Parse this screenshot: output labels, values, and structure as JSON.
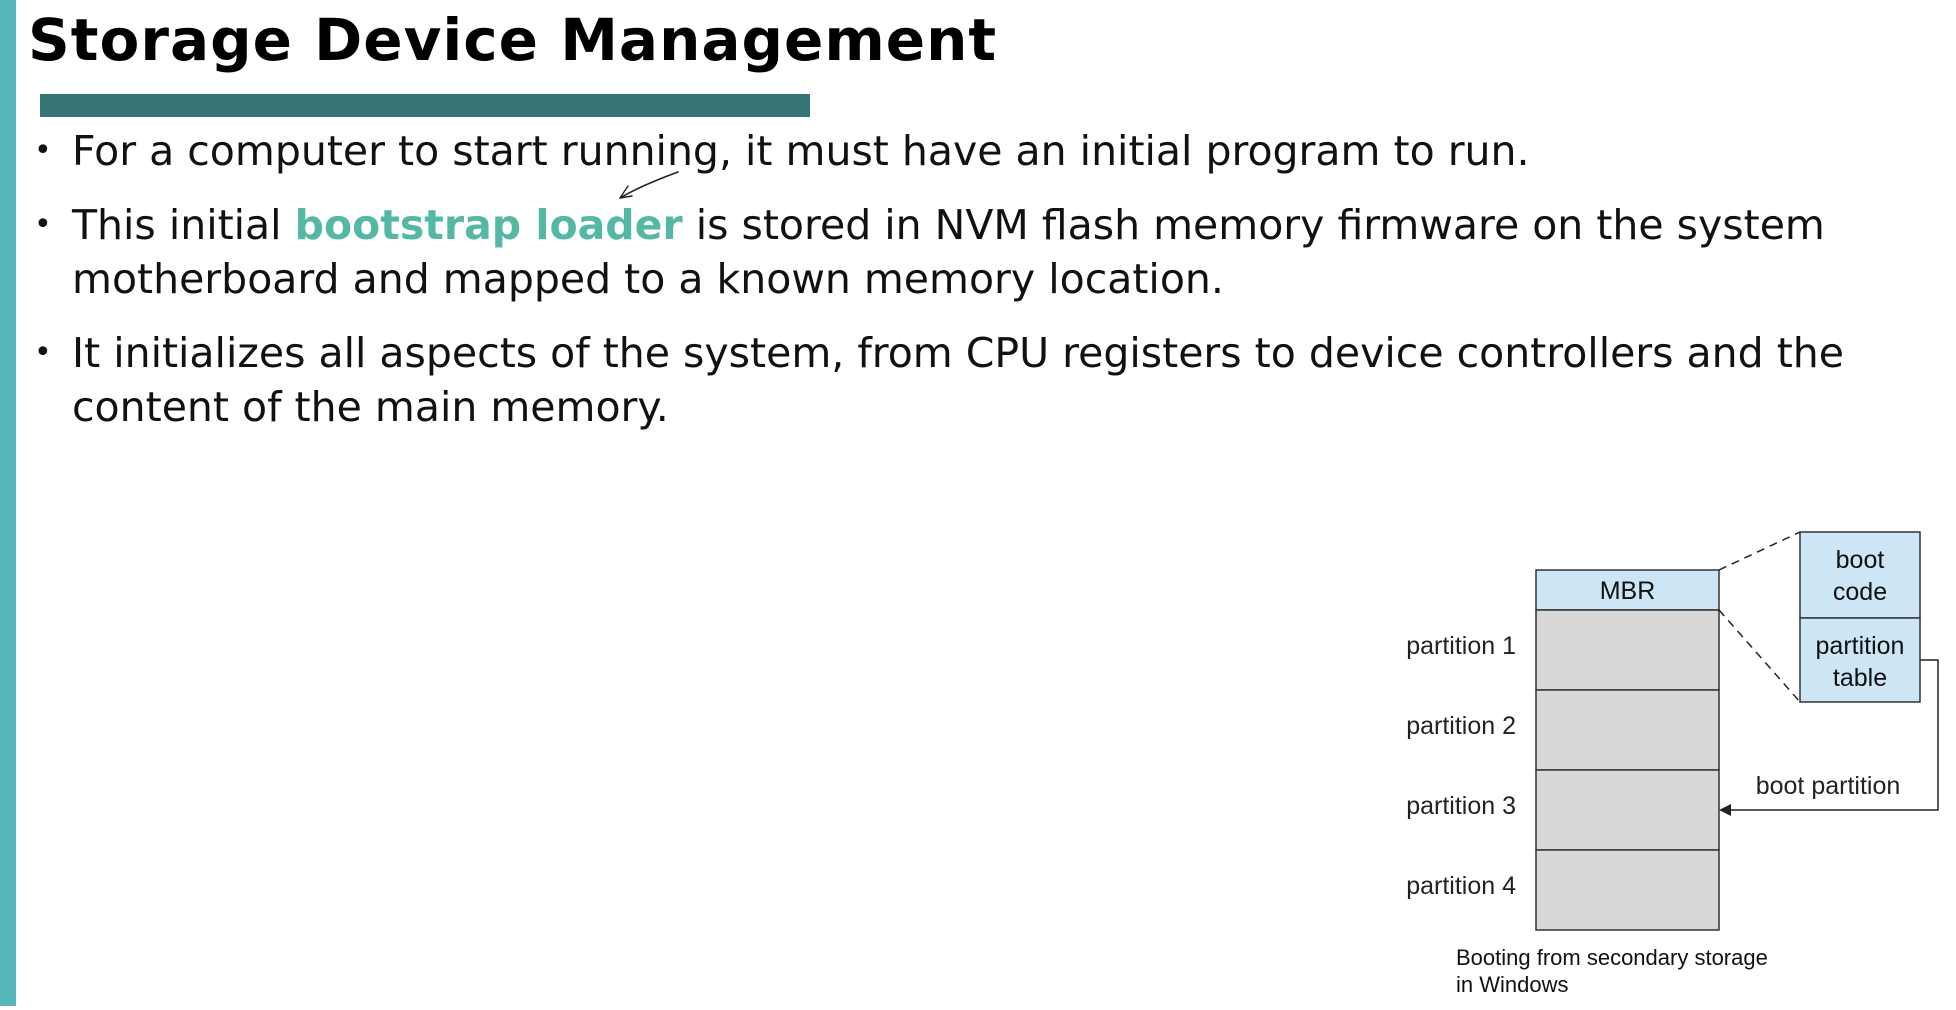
{
  "slide": {
    "title": "Storage Device Management",
    "colors": {
      "accent_teal": "#55b8b8",
      "title_bar": "#357575",
      "highlight": "#55b8a4"
    },
    "bullets": [
      {
        "text": "For a computer to start running, it must have an initial program to run."
      },
      {
        "before": "This initial ",
        "highlight": "bootstrap loader",
        "after": " is stored in NVM flash memory firmware on the system motherboard and mapped to a known memory location."
      },
      {
        "text": "It initializes all aspects of the system, from CPU registers to device controllers and the content of the main memory."
      }
    ]
  },
  "diagram": {
    "mbr_label": "MBR",
    "partitions": [
      "partition 1",
      "partition 2",
      "partition 3",
      "partition 4"
    ],
    "boot_code": [
      "boot",
      "code"
    ],
    "partition_table": [
      "partition",
      "table"
    ],
    "boot_partition_label": "boot partition",
    "caption": "Booting from secondary storage in  Windows",
    "colors": {
      "mbr_fill": "#cde6f5",
      "partition_fill": "#d8d8d8"
    }
  }
}
